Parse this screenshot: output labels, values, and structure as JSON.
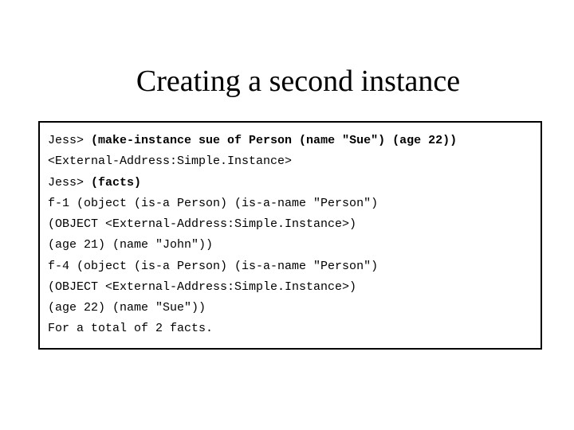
{
  "title": "Creating a second instance",
  "code": {
    "line1_prompt": "Jess> ",
    "line1_cmd": "(make-instance sue of Person (name \"Sue\") (age 22))",
    "line2": "<External-Address:Simple.Instance>",
    "line3_prompt": "Jess> ",
    "line3_cmd": "(facts)",
    "line4": "f-1 (object (is-a Person) (is-a-name \"Person\")",
    "line5": "(OBJECT <External-Address:Simple.Instance>)",
    "line6": "(age 21) (name \"John\"))",
    "line7": "f-4 (object (is-a Person) (is-a-name \"Person\")",
    "line8": "(OBJECT <External-Address:Simple.Instance>)",
    "line9": "(age 22) (name \"Sue\"))",
    "line10": "For a total of 2 facts."
  }
}
